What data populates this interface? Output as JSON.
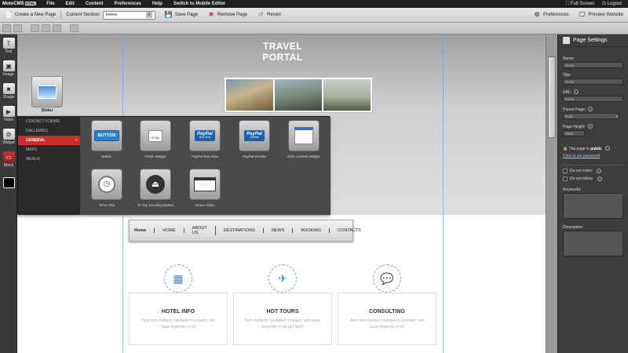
{
  "menubar": {
    "app_name": "MotoCMS",
    "app_badge": "HTML",
    "items": [
      "File",
      "Edit",
      "Content",
      "Preferences",
      "Help",
      "Switch to Mobile Editor"
    ],
    "full_screen": "Full Screen",
    "logout": "Logout"
  },
  "toolbar": {
    "create_page": "Create a New Page",
    "current_section_label": "Current Section:",
    "current_section_value": "Home",
    "save_page": "Save Page",
    "remove_page": "Remove Page",
    "revert": "Revert",
    "preferences": "Preferences",
    "preview": "Preview Website"
  },
  "left_tools": [
    "Text",
    "Image",
    "Shape",
    "Video",
    "Widget",
    "Block"
  ],
  "site": {
    "title": "TRAVEL PORTAL",
    "slider_label": "Slider"
  },
  "widget_panel": {
    "categories": [
      "CONTACT FORMS",
      "GALLERIES",
      "GENERAL",
      "MAPS",
      "MENUS"
    ],
    "active_category": "GENERAL",
    "items": [
      "Button",
      "HTML Widget",
      "PayPal Buy Now",
      "PayPal Donate",
      "Rich Content Widget",
      "Timer Slot",
      "To Top Scrolling Button",
      "Vimeo Video"
    ],
    "button_icon_text": "BUTTON",
    "html_icon_text": "HTML",
    "paypal_text": "PayPal",
    "paypal_buy_sub": "Buy Now",
    "paypal_donate_sub": "Donate",
    "vimeo_icon_text": "vimeo"
  },
  "nav": {
    "items": [
      "Home",
      "HOME",
      "ABOUT US",
      "DESTINATIONS",
      "NEWS",
      "BOOKING",
      "CONTACTS"
    ]
  },
  "services": [
    {
      "title": "HOTEL INFO",
      "desc": "Typi non habent claritatem insitam; est usus legentis in iis"
    },
    {
      "title": "HOT TOURS",
      "desc": "Non habent claritatem insitam; est usus legentis in iis qui facit"
    },
    {
      "title": "CONSULTING",
      "desc": "Aen non habent claritatem insitam; est usus legentis in iis"
    }
  ],
  "settings": {
    "title": "Page Settings",
    "name_label": "Name:",
    "name_value": "Home",
    "title_label": "Title:",
    "title_value": "Home",
    "url_label": "URL:",
    "url_value": "home",
    "parent_label": "Parent Page:",
    "parent_value": "Root",
    "height_label": "Page Height:",
    "height_value": "3366",
    "public_text": "The page is",
    "public_word": "public",
    "password_link": "Click to set password",
    "noindex": "Do not index",
    "nofollow": "Do not follow",
    "keywords_label": "Keywords:",
    "description_label": "Description:"
  },
  "colors": {
    "accent_red": "#c9302c",
    "accent_blue": "#3a90d8"
  }
}
